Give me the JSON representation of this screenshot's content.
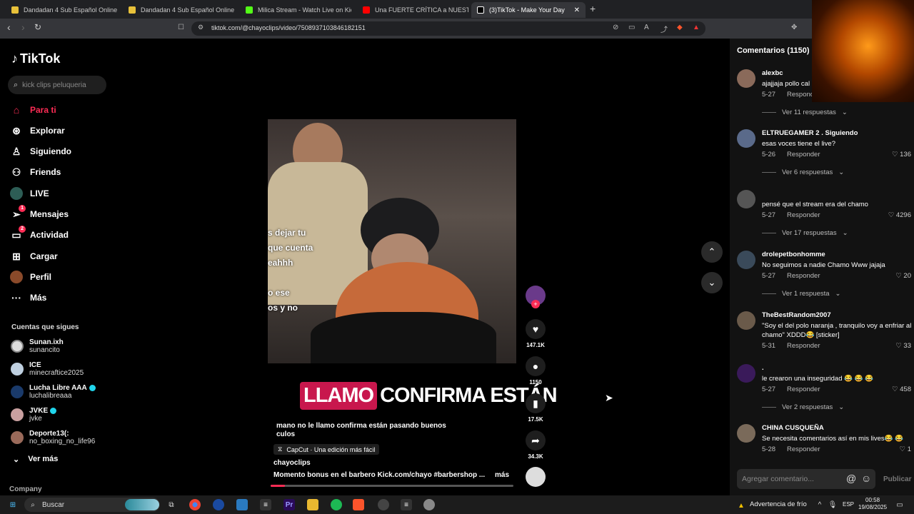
{
  "browser": {
    "tabs": [
      {
        "label": "Dandadan 4 Sub Español Online grat",
        "color": "#e8c13a"
      },
      {
        "label": "Dandadan 4 Sub Español Online grat",
        "color": "#e8c13a"
      },
      {
        "label": "Milica Stream - Watch Live on Kick",
        "color": "#53fc18"
      },
      {
        "label": "Una FUERTE CRÍTICA a NUESTRA SOC",
        "color": "#ff0000"
      },
      {
        "label": "(3)TikTok - Make Your Day",
        "color": "#ffffff"
      }
    ],
    "url": "tiktok.com/@chayoclips/video/7508937103846182151"
  },
  "sidebar": {
    "logo": "TikTok",
    "search_placeholder": "kick clips peluqueria",
    "nav": [
      {
        "label": "Para ti",
        "icon": "home-icon",
        "active": true,
        "badge": ""
      },
      {
        "label": "Explorar",
        "icon": "compass-icon",
        "badge": ""
      },
      {
        "label": "Siguiendo",
        "icon": "following-icon",
        "badge": ""
      },
      {
        "label": "Friends",
        "icon": "friends-icon",
        "badge": ""
      },
      {
        "label": "LIVE",
        "icon": "live-icon",
        "badge": ""
      },
      {
        "label": "Mensajes",
        "icon": "messages-icon",
        "badge": "1"
      },
      {
        "label": "Actividad",
        "icon": "activity-icon",
        "badge": "2"
      },
      {
        "label": "Cargar",
        "icon": "upload-icon",
        "badge": ""
      },
      {
        "label": "Perfil",
        "icon": "profile-icon",
        "badge": ""
      },
      {
        "label": "Más",
        "icon": "more-icon",
        "badge": ""
      }
    ],
    "following_title": "Cuentas que sigues",
    "following": [
      {
        "name": "Sunan.ixh",
        "handle": "sunancito",
        "verified": false
      },
      {
        "name": "ICE",
        "handle": "minecraftice2025",
        "verified": false
      },
      {
        "name": "Lucha Libre AAA",
        "handle": "luchalibreaaa",
        "verified": true
      },
      {
        "name": "JVKE",
        "handle": "jvke",
        "verified": true
      },
      {
        "name": "Deporte13(:",
        "handle": "no_boxing_no_life96",
        "verified": false
      }
    ],
    "see_more": "Ver más",
    "company": "Company"
  },
  "video": {
    "overlay_text": [
      "s dejar tu",
      "que cuenta",
      "eahhh",
      "",
      "o ese",
      "os y no"
    ],
    "caption_highlight": "LLAMO",
    "caption_rest": "CONFIRMA ESTÁN",
    "description": "mano no le llamo confirma están pasando buenos culos",
    "capcut": "CapCut · Una edición más fácil",
    "author": "chayoclips",
    "music": "Momento bonus en el barbero Kick.com/chayo #barbershop ...",
    "more": "más",
    "progress": 0.06,
    "likes": "147.1K",
    "comments": "1150",
    "saves": "17.5K",
    "shares": "34.3K"
  },
  "comments": {
    "title": "Comentarios (1150)",
    "items": [
      {
        "user": "alexbc",
        "text": "ajajjaja pollo cal",
        "date": "5-27",
        "reply": "Responder",
        "likes": "",
        "replies": "Ver 11 respuestas",
        "color": "#8a6a5a"
      },
      {
        "user": "ELTRUEGAMER 2 . Siguiendo",
        "text": "esas voces tiene el live?",
        "date": "5-26",
        "reply": "Responder",
        "likes": "136",
        "replies": "Ver 6 respuestas",
        "color": "#5a6a8a"
      },
      {
        "user": "",
        "text": "pensé que el stream era del chamo",
        "date": "5-27",
        "reply": "Responder",
        "likes": "4296",
        "replies": "Ver 17 respuestas",
        "color": "#555555"
      },
      {
        "user": "drolepetbonhomme",
        "text": "No seguimos a nadie Chamo Www jajaja",
        "date": "5-27",
        "reply": "Responder",
        "likes": "20",
        "replies": "Ver 1 respuesta",
        "color": "#3a4a5a"
      },
      {
        "user": "TheBestRandom2007",
        "text": "\"Soy el del polo naranja , tranquilo voy a enfriar al chamo\" XDDD😂 [sticker]",
        "date": "5-31",
        "reply": "Responder",
        "likes": "33",
        "replies": "",
        "color": "#6a5a4a"
      },
      {
        "user": ".",
        "text": "le crearon una inseguridad 😂 😂 😂",
        "date": "5-27",
        "reply": "Responder",
        "likes": "458",
        "replies": "Ver 2 respuestas",
        "color": "#3a1a5a"
      },
      {
        "user": "CHINA CUSQUEÑA",
        "text": "Se necesita comentarios así en mis lives😂 😂",
        "date": "5-28",
        "reply": "Responder",
        "likes": "1",
        "replies": "",
        "color": "#7a6a5a"
      }
    ],
    "input_placeholder": "Agregar comentario...",
    "publish": "Publicar"
  },
  "taskbar": {
    "search": "Buscar",
    "weather": "Advertencia de frío",
    "lang": "ESP",
    "time": "00:58",
    "date": "19/08/2025"
  }
}
